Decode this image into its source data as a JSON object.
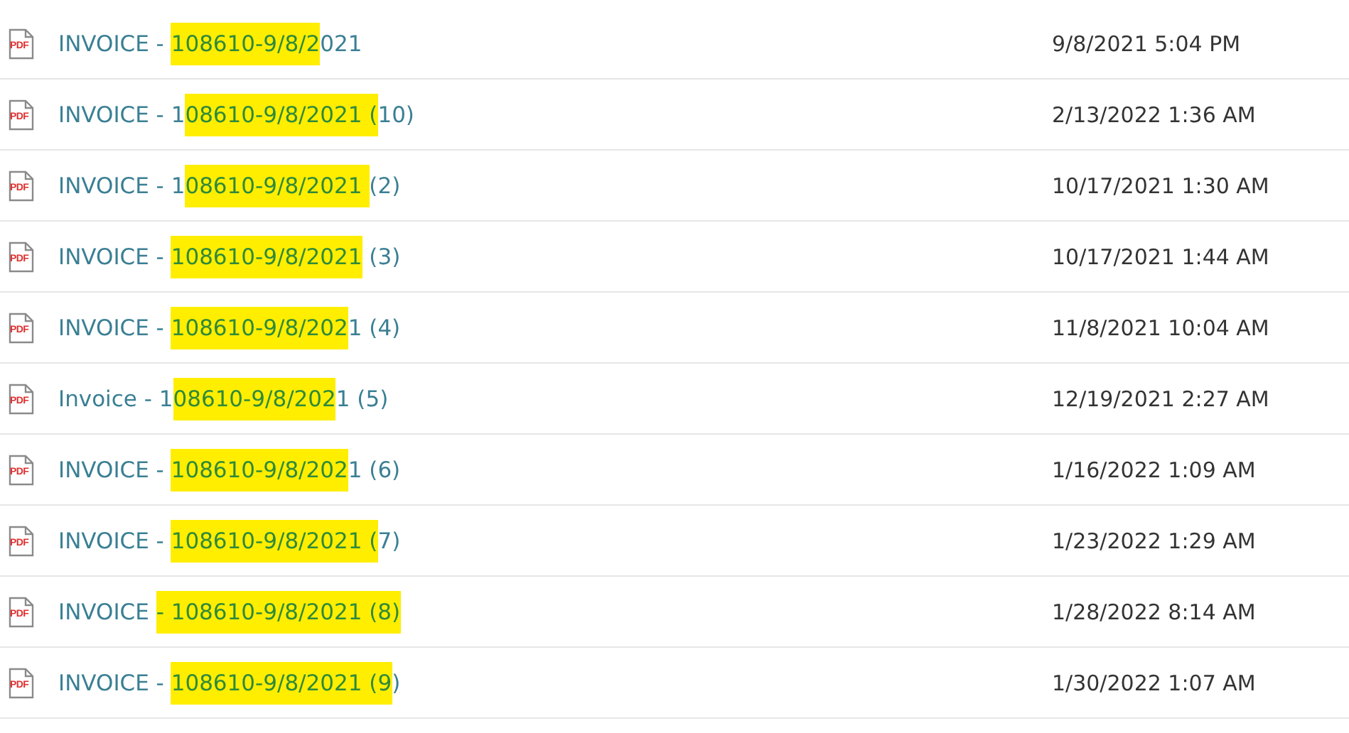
{
  "files": [
    {
      "icon_label": "PDF",
      "name_parts": [
        {
          "text": "INVOICE - ",
          "marked": false
        },
        {
          "text": "108610-9/8/2",
          "marked": true
        },
        {
          "text": "021",
          "marked": false
        }
      ],
      "modified": "9/8/2021 5:04 PM"
    },
    {
      "icon_label": "PDF",
      "name_parts": [
        {
          "text": "INVOICE - 1",
          "marked": false
        },
        {
          "text": "08610-9/8/2021 (",
          "marked": true
        },
        {
          "text": "10)",
          "marked": false
        }
      ],
      "modified": "2/13/2022 1:36 AM"
    },
    {
      "icon_label": "PDF",
      "name_parts": [
        {
          "text": "INVOICE - 1",
          "marked": false
        },
        {
          "text": "08610-9/8/2021 ",
          "marked": true
        },
        {
          "text": "(2)",
          "marked": false
        }
      ],
      "modified": "10/17/2021 1:30 AM"
    },
    {
      "icon_label": "PDF",
      "name_parts": [
        {
          "text": "INVOICE - ",
          "marked": false
        },
        {
          "text": "108610-9/8/2021",
          "marked": true
        },
        {
          "text": " (3)",
          "marked": false
        }
      ],
      "modified": "10/17/2021 1:44 AM"
    },
    {
      "icon_label": "PDF",
      "name_parts": [
        {
          "text": "INVOICE - ",
          "marked": false
        },
        {
          "text": "108610-9/8/202",
          "marked": true
        },
        {
          "text": "1 (4)",
          "marked": false
        }
      ],
      "modified": "11/8/2021 10:04 AM"
    },
    {
      "icon_label": "PDF",
      "name_parts": [
        {
          "text": "Invoice - 1",
          "marked": false
        },
        {
          "text": "08610-9/8/202",
          "marked": true
        },
        {
          "text": "1 (5)",
          "marked": false
        }
      ],
      "modified": "12/19/2021 2:27 AM"
    },
    {
      "icon_label": "PDF",
      "name_parts": [
        {
          "text": "INVOICE - ",
          "marked": false
        },
        {
          "text": "108610-9/8/202",
          "marked": true
        },
        {
          "text": "1 (6)",
          "marked": false
        }
      ],
      "modified": "1/16/2022 1:09 AM"
    },
    {
      "icon_label": "PDF",
      "name_parts": [
        {
          "text": "INVOICE - ",
          "marked": false
        },
        {
          "text": "108610-9/8/2021 (",
          "marked": true
        },
        {
          "text": "7)",
          "marked": false
        }
      ],
      "modified": "1/23/2022 1:29 AM"
    },
    {
      "icon_label": "PDF",
      "name_parts": [
        {
          "text": "INVOICE ",
          "marked": false
        },
        {
          "text": "- 108610-9/8/2021 (8)",
          "marked": true
        }
      ],
      "modified": "1/28/2022 8:14 AM"
    },
    {
      "icon_label": "PDF",
      "name_parts": [
        {
          "text": "INVOICE - ",
          "marked": false
        },
        {
          "text": "108610-9/8/2021 (9",
          "marked": true
        },
        {
          "text": ")",
          "marked": false
        }
      ],
      "modified": "1/30/2022 1:07 AM"
    }
  ]
}
